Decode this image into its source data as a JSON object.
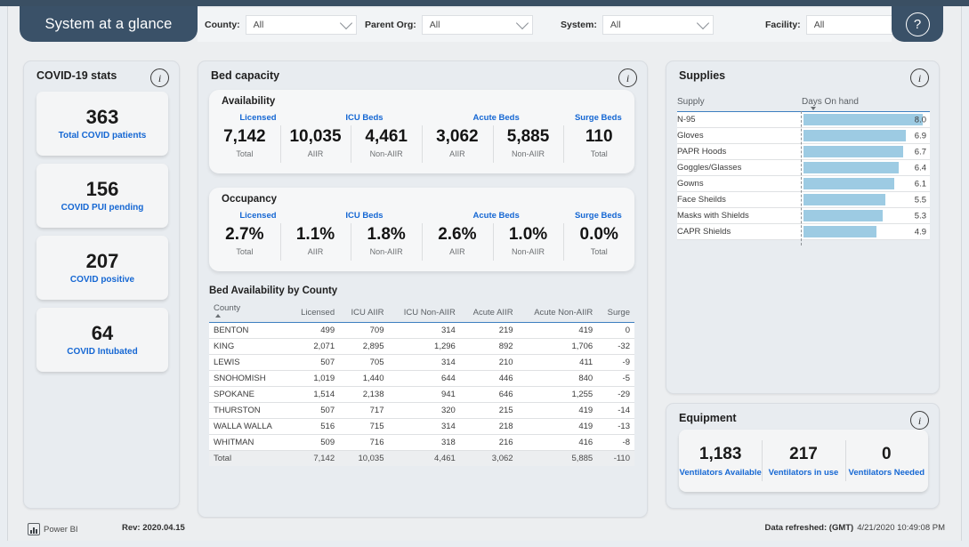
{
  "header": {
    "title": "System at a glance",
    "help_icon": "question-mark-icon",
    "filters": [
      {
        "label": "County:",
        "value": "All"
      },
      {
        "label": "Parent Org:",
        "value": "All"
      },
      {
        "label": "System:",
        "value": "All"
      },
      {
        "label": "Facility:",
        "value": "All"
      }
    ]
  },
  "covid_stats": {
    "title": "COVID-19 stats",
    "cards": [
      {
        "value": "363",
        "label": "Total COVID patients"
      },
      {
        "value": "156",
        "label": "COVID PUI pending"
      },
      {
        "value": "207",
        "label": "COVID positive"
      },
      {
        "value": "64",
        "label": "COVID Intubated"
      }
    ]
  },
  "bed_capacity": {
    "title": "Bed capacity",
    "groups": [
      {
        "name": "Licensed",
        "left_pct": 2,
        "width_pct": 19
      },
      {
        "name": "ICU Beds",
        "left_pct": 21,
        "width_pct": 31
      },
      {
        "name": "Acute Beds",
        "left_pct": 52,
        "width_pct": 31
      },
      {
        "name": "Surge Beds",
        "left_pct": 83,
        "width_pct": 17
      }
    ],
    "availability": {
      "title": "Availability",
      "cells": [
        {
          "value": "7,142",
          "sub": "Total"
        },
        {
          "value": "10,035",
          "sub": "AIIR"
        },
        {
          "value": "4,461",
          "sub": "Non-AIIR"
        },
        {
          "value": "3,062",
          "sub": "AIIR"
        },
        {
          "value": "5,885",
          "sub": "Non-AIIR"
        },
        {
          "value": "110",
          "sub": "Total"
        }
      ]
    },
    "occupancy": {
      "title": "Occupancy",
      "cells": [
        {
          "value": "2.7%",
          "sub": "Total"
        },
        {
          "value": "1.1%",
          "sub": "AIIR"
        },
        {
          "value": "1.8%",
          "sub": "Non-AIIR"
        },
        {
          "value": "2.6%",
          "sub": "AIIR"
        },
        {
          "value": "1.0%",
          "sub": "Non-AIIR"
        },
        {
          "value": "0.0%",
          "sub": "Total"
        }
      ]
    },
    "table": {
      "title": "Bed Availability by County",
      "columns": [
        "County",
        "Licensed",
        "ICU AIIR",
        "ICU Non-AIIR",
        "Acute AIIR",
        "Acute Non-AIIR",
        "Surge"
      ],
      "sorted_column": "County",
      "sort_direction": "asc",
      "rows": [
        [
          "BENTON",
          "499",
          "709",
          "314",
          "219",
          "419",
          "0"
        ],
        [
          "KING",
          "2,071",
          "2,895",
          "1,296",
          "892",
          "1,706",
          "-32"
        ],
        [
          "LEWIS",
          "507",
          "705",
          "314",
          "210",
          "411",
          "-9"
        ],
        [
          "SNOHOMISH",
          "1,019",
          "1,440",
          "644",
          "446",
          "840",
          "-5"
        ],
        [
          "SPOKANE",
          "1,514",
          "2,138",
          "941",
          "646",
          "1,255",
          "-29"
        ],
        [
          "THURSTON",
          "507",
          "717",
          "320",
          "215",
          "419",
          "-14"
        ],
        [
          "WALLA WALLA",
          "516",
          "715",
          "314",
          "218",
          "419",
          "-13"
        ],
        [
          "WHITMAN",
          "509",
          "716",
          "318",
          "216",
          "416",
          "-8"
        ]
      ],
      "total_row": [
        "Total",
        "7,142",
        "10,035",
        "4,461",
        "3,062",
        "5,885",
        "-110"
      ]
    }
  },
  "supplies": {
    "title": "Supplies",
    "columns": [
      "Supply",
      "Days On hand"
    ],
    "sorted_column": "Days On hand",
    "sort_direction": "desc",
    "bar_color": "#9dcbe3",
    "max_value": 8.5,
    "rows": [
      {
        "name": "N-95",
        "value": "8.0",
        "num": 8.0
      },
      {
        "name": "Gloves",
        "value": "6.9",
        "num": 6.9
      },
      {
        "name": "PAPR Hoods",
        "value": "6.7",
        "num": 6.7
      },
      {
        "name": "Goggles/Glasses",
        "value": "6.4",
        "num": 6.4
      },
      {
        "name": "Gowns",
        "value": "6.1",
        "num": 6.1
      },
      {
        "name": "Face Sheilds",
        "value": "5.5",
        "num": 5.5
      },
      {
        "name": "Masks with Shields",
        "value": "5.3",
        "num": 5.3
      },
      {
        "name": "CAPR Shields",
        "value": "4.9",
        "num": 4.9
      }
    ]
  },
  "equipment": {
    "title": "Equipment",
    "cells": [
      {
        "value": "1,183",
        "label": "Ventilators Available"
      },
      {
        "value": "217",
        "label": "Ventilators in use"
      },
      {
        "value": "0",
        "label": "Ventilators Needed"
      }
    ]
  },
  "footer": {
    "powerbi": "Power BI",
    "revision": "Rev: 2020.04.15",
    "refreshed_label": "Data refreshed: (GMT)",
    "refreshed_time": "4/21/2020 10:49:08 PM"
  }
}
